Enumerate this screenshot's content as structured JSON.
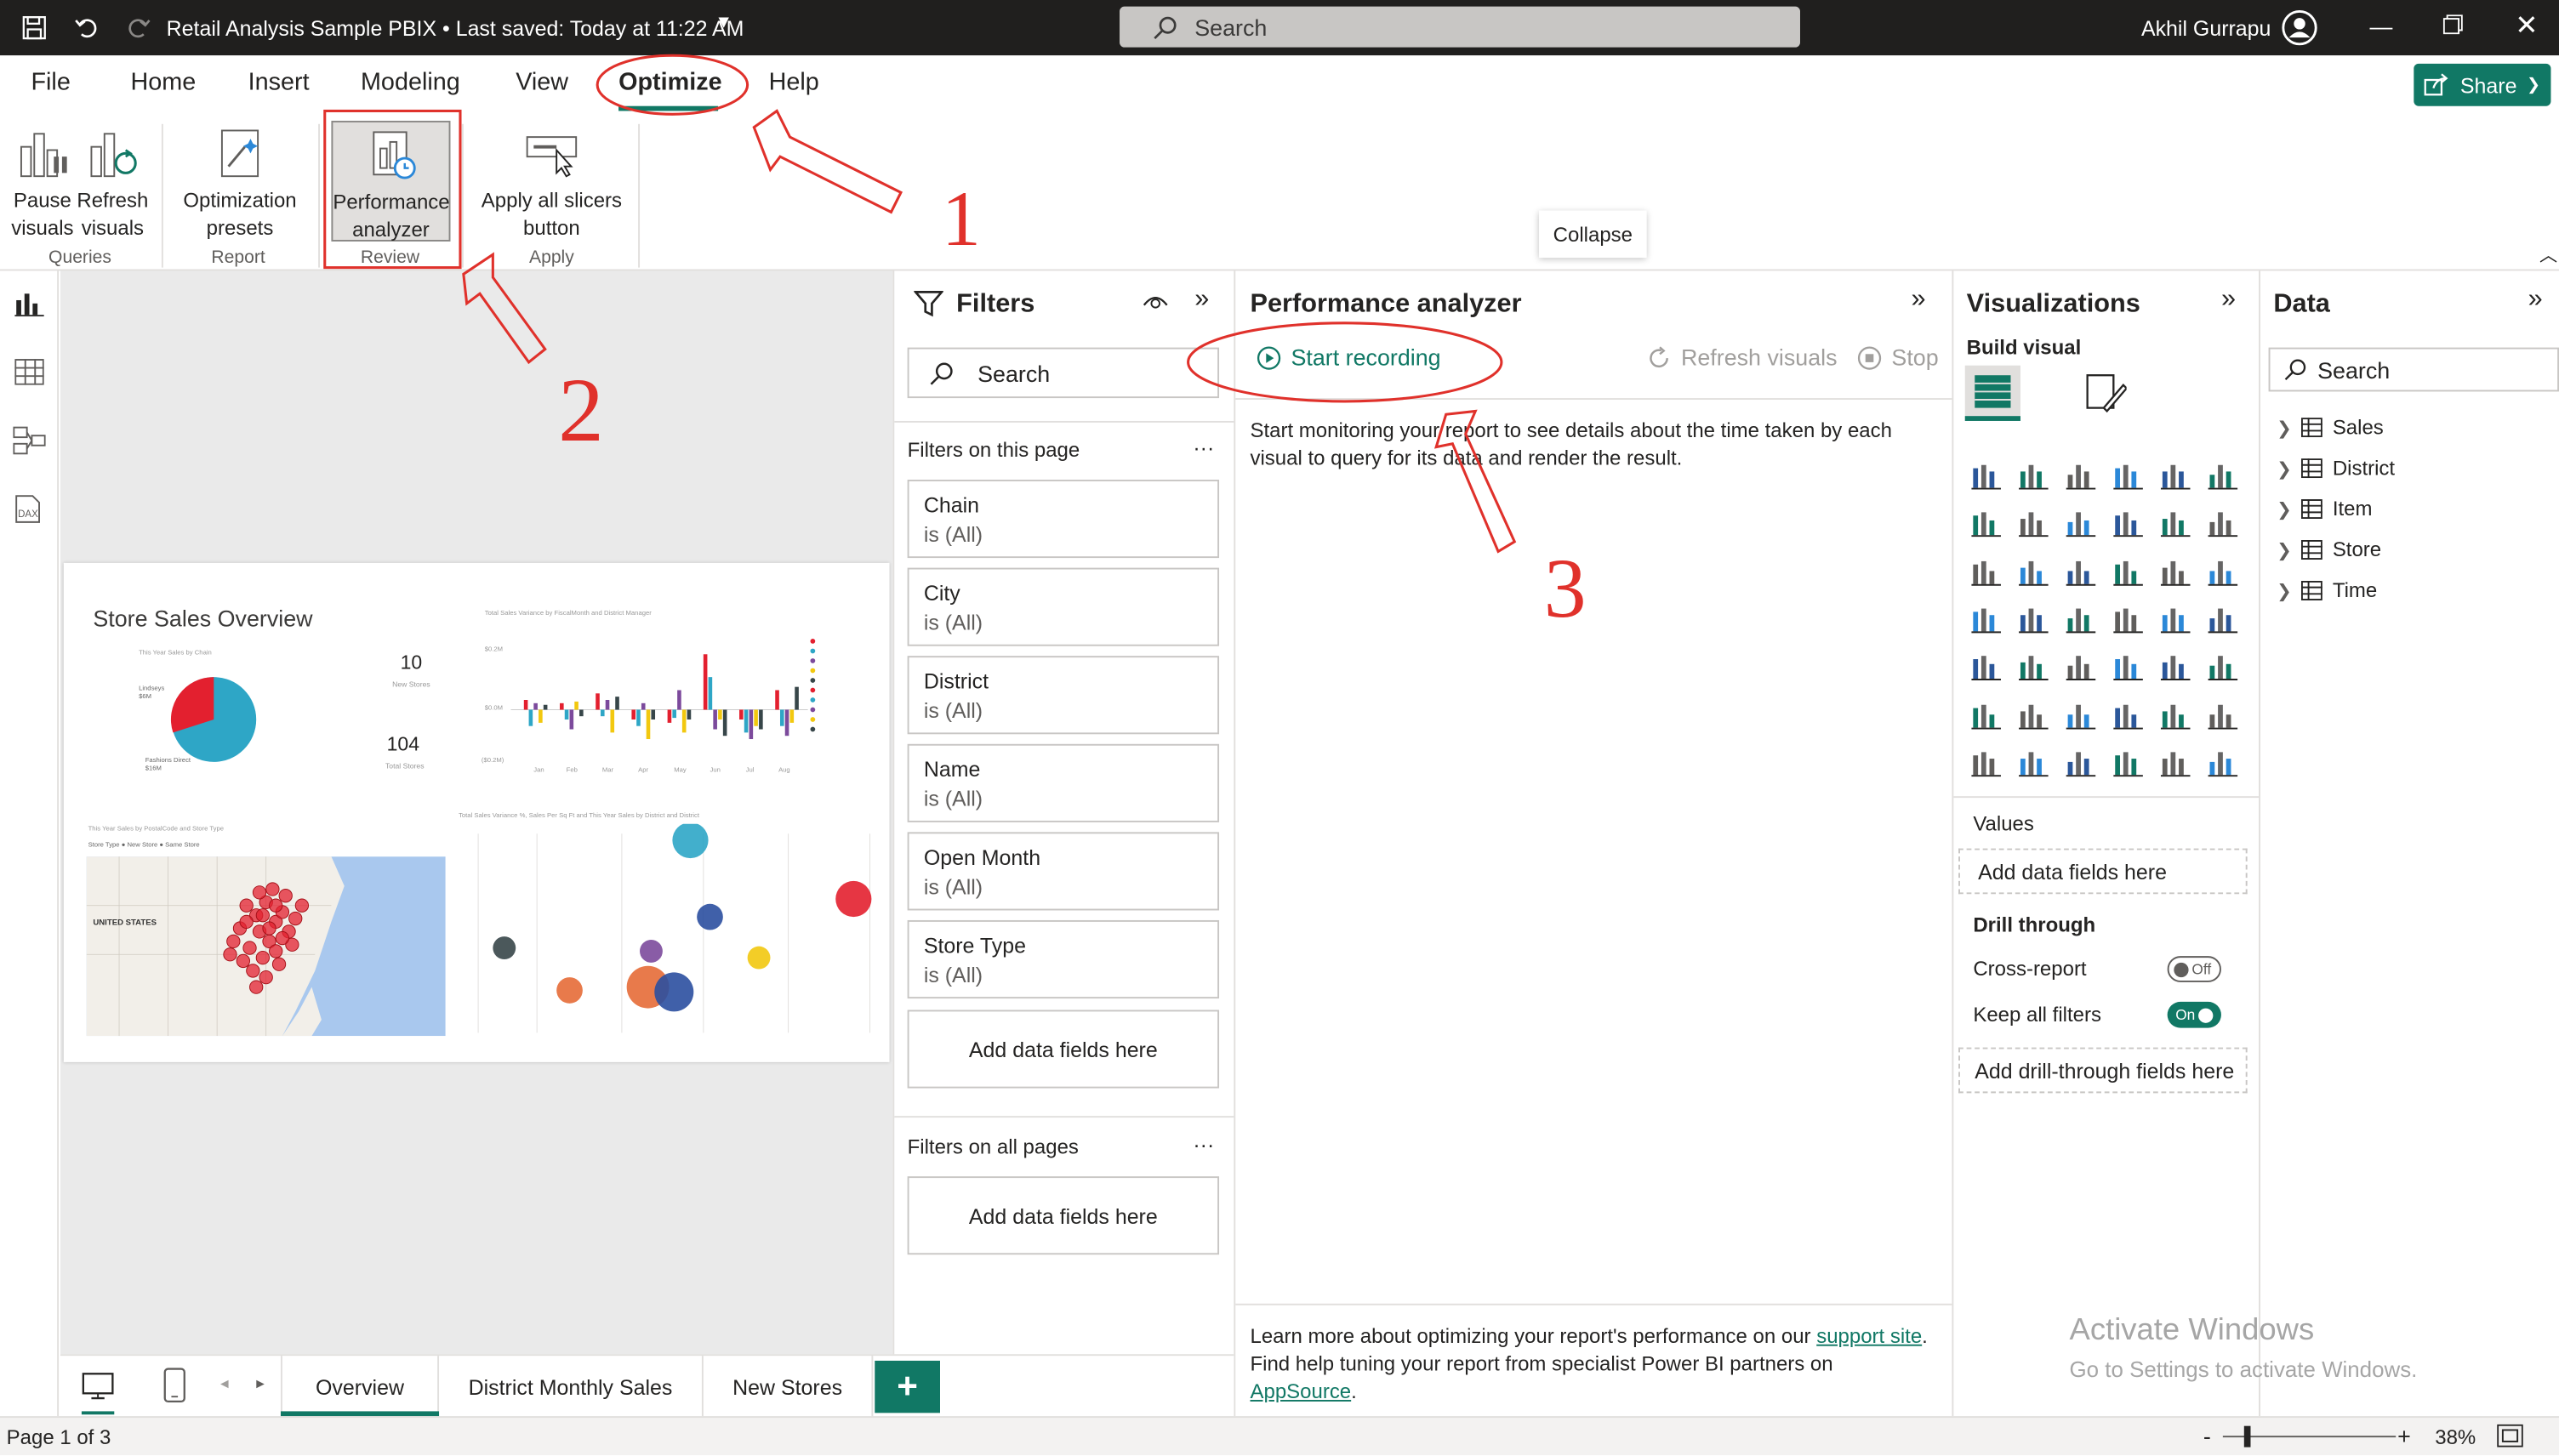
{
  "titlebar": {
    "title": "Retail Analysis Sample PBIX • Last saved: Today at 11:22 AM",
    "search_placeholder": "Search",
    "user": "Akhil Gurrapu"
  },
  "menu": {
    "items": [
      "File",
      "Home",
      "Insert",
      "Modeling",
      "View",
      "Optimize",
      "Help"
    ],
    "share": "Share"
  },
  "ribbon": {
    "pause_label": "Pause\nvisuals",
    "refresh_label": "Refresh\nvisuals",
    "queries_group": "Queries",
    "presets_label": "Optimization\npresets",
    "report_group": "Report",
    "perf_label": "Performance\nanalyzer",
    "review_group": "Review",
    "apply_label": "Apply all slicers\nbutton",
    "apply_group": "Apply",
    "collapse_tooltip": "Collapse"
  },
  "report": {
    "title": "Store Sales Overview",
    "kpi1_value": "10",
    "kpi1_label": "New Stores",
    "kpi2_value": "104",
    "kpi2_label": "Total Stores",
    "pie_title": "This Year Sales by Chain",
    "bar_title": "Total Sales Variance by FiscalMonth and District Manager",
    "map_title": "This Year Sales by PostalCode and Store Type",
    "scatter_title": "Total Sales Variance %, Sales Per Sq Ft and This Year Sales by District and District",
    "map_country": "UNITED STATES",
    "map_legend": "Store Type ● New Store ● Same Store"
  },
  "filters": {
    "title": "Filters",
    "search": "Search",
    "this_page": "Filters on this page",
    "all_pages": "Filters on all pages",
    "cards": [
      {
        "name": "Chain",
        "value": "is (All)"
      },
      {
        "name": "City",
        "value": "is (All)"
      },
      {
        "name": "District",
        "value": "is (All)"
      },
      {
        "name": "Name",
        "value": "is (All)"
      },
      {
        "name": "Open Month",
        "value": "is (All)"
      },
      {
        "name": "Store Type",
        "value": "is (All)"
      }
    ],
    "add_fields": "Add data fields here",
    "add_fields_all": "Add data fields here"
  },
  "perf": {
    "title": "Performance analyzer",
    "start": "Start recording",
    "refresh": "Refresh visuals",
    "stop": "Stop",
    "desc": "Start monitoring your report to see details about the time taken by each visual to query for its data and render the result.",
    "footer1": "Learn more about optimizing your report's performance on our ",
    "footer1_link": "support site",
    "footer2": "Find help tuning your report from specialist Power BI partners on ",
    "footer2_link": "AppSource"
  },
  "viz": {
    "title": "Visualizations",
    "build": "Build visual",
    "values": "Values",
    "values_add": "Add data fields here",
    "drill": "Drill through",
    "cross": "Cross-report",
    "cross_state": "Off",
    "keep": "Keep all filters",
    "keep_state": "On",
    "drill_add": "Add drill-through fields here"
  },
  "data": {
    "title": "Data",
    "search": "Search",
    "tables": [
      "Sales",
      "District",
      "Item",
      "Store",
      "Time"
    ]
  },
  "tabs": {
    "items": [
      "Overview",
      "District Monthly Sales",
      "New Stores"
    ]
  },
  "status": {
    "page": "Page 1 of 3",
    "zoom": "38%"
  },
  "watermark": {
    "line1": "Activate Windows",
    "line2": "Go to Settings to activate Windows."
  },
  "annotations": {
    "n1": "1",
    "n2": "2",
    "n3": "3"
  },
  "colors": {
    "accent": "#117865",
    "annotation": "#e0312b",
    "titlebar": "#201f1e"
  }
}
